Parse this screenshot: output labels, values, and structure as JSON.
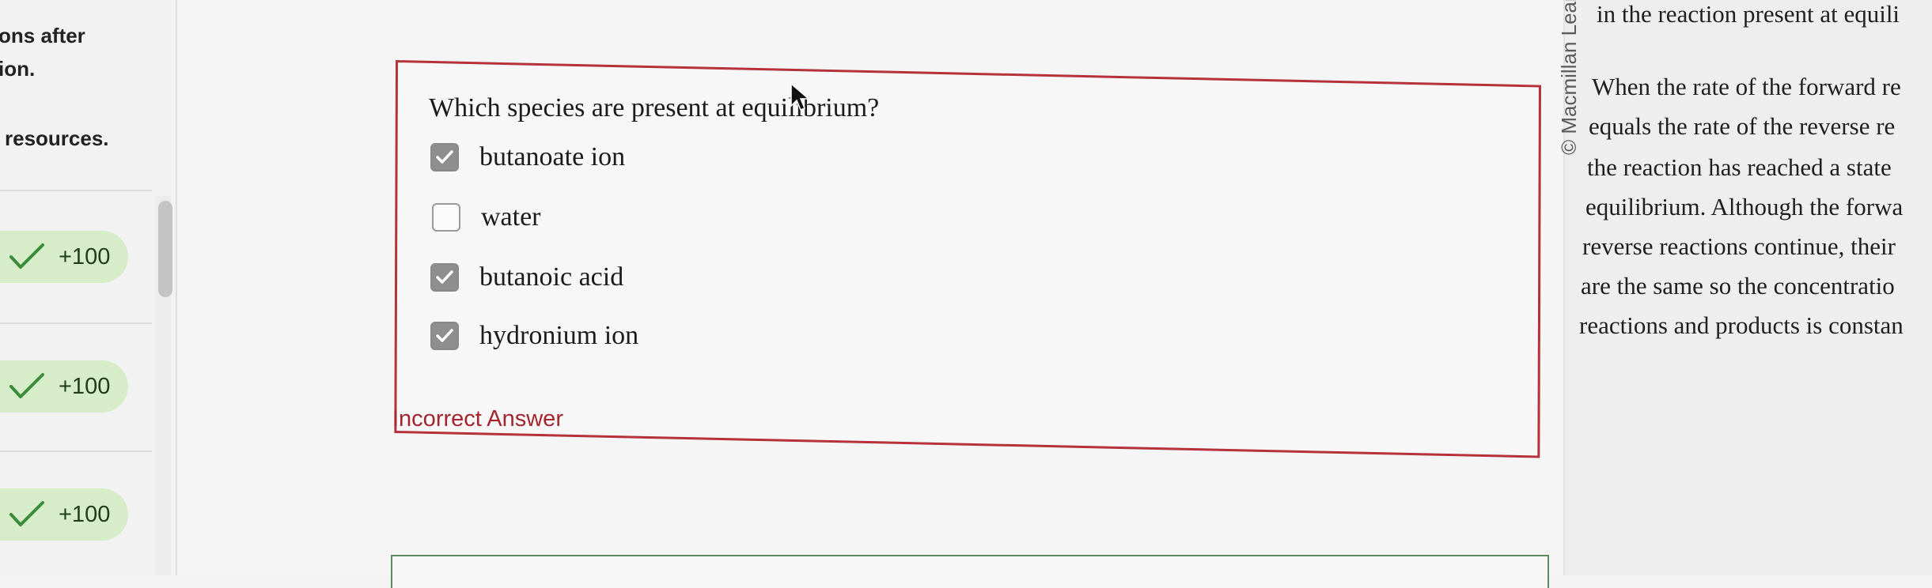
{
  "sidebar": {
    "lines": [
      "ons after",
      "ion.",
      "resources."
    ],
    "scores": [
      "+100",
      "+100",
      "+100"
    ]
  },
  "question": {
    "prompt": "Which species are present at equilibrium?",
    "options": [
      {
        "label": "butanoate ion",
        "checked": true
      },
      {
        "label": "water",
        "checked": false
      },
      {
        "label": "butanoic acid",
        "checked": true
      },
      {
        "label": "hydronium ion",
        "checked": true
      }
    ],
    "feedback": "Incorrect Answer"
  },
  "right_panel": {
    "copyright": "© Macmillan Lear",
    "lines": [
      "in the reaction present at equili",
      "When the rate of the forward re",
      "equals the rate of the reverse re",
      "the reaction has reached a state",
      "equilibrium. Although the forwa",
      "reverse reactions continue, their",
      "are the same so the concentratio",
      "reactions and products is constan"
    ]
  },
  "colors": {
    "accent_red": "#b5323b",
    "feedback_red": "#a3262f",
    "badge_green": "#d7ecc9",
    "check_green": "#3a8b3a"
  }
}
